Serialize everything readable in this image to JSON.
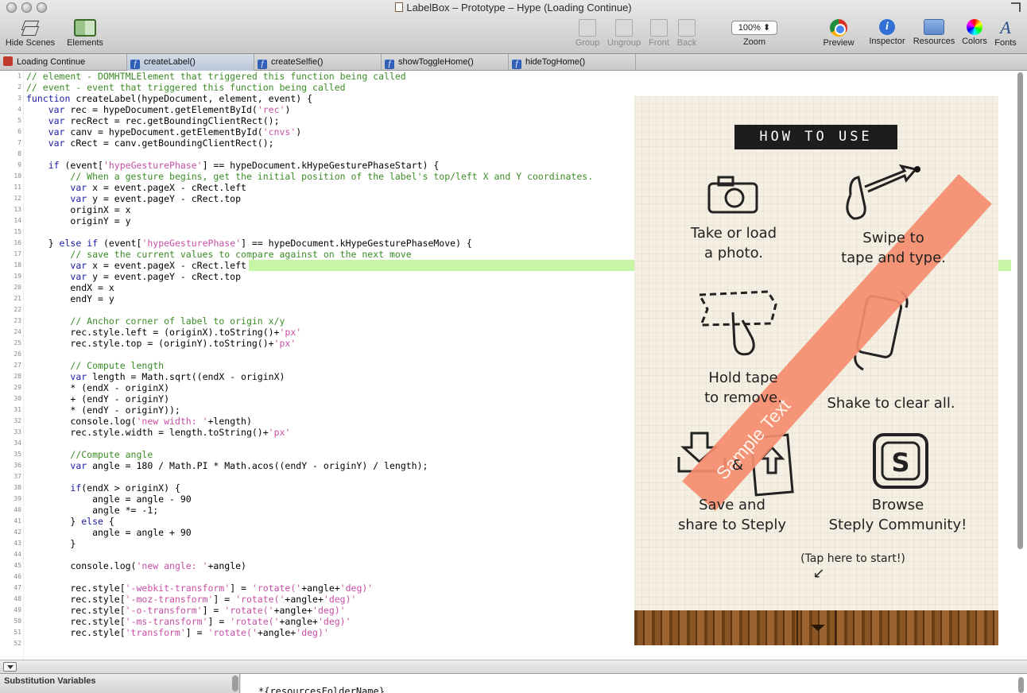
{
  "window": {
    "title": "LabelBox – Prototype – Hype (Loading Continue)"
  },
  "toolbar": {
    "hide_scenes": "Hide Scenes",
    "elements": "Elements",
    "group": "Group",
    "ungroup": "Ungroup",
    "front": "Front",
    "back": "Back",
    "zoom_value": "100%",
    "zoom_label": "Zoom",
    "preview": "Preview",
    "inspector": "Inspector",
    "resources": "Resources",
    "colors": "Colors",
    "fonts": "Fonts"
  },
  "tabs": [
    {
      "label": "Loading Continue",
      "kind": "scene",
      "active": false
    },
    {
      "label": "createLabel()",
      "kind": "function",
      "active": true
    },
    {
      "label": "createSelfie()",
      "kind": "function",
      "active": false
    },
    {
      "label": "showToggleHome()",
      "kind": "function",
      "active": false
    },
    {
      "label": "hideTogHome()",
      "kind": "function",
      "active": false
    }
  ],
  "code": {
    "highlighted_line": 18,
    "lines": [
      {
        "n": "1",
        "text": "// element - DOMHTMLElement that triggered this function being called"
      },
      {
        "n": "2",
        "text": "// event - event that triggered this function being called"
      },
      {
        "n": "3",
        "text": "function createLabel(hypeDocument, element, event) {"
      },
      {
        "n": "4",
        "text": "    var rec = hypeDocument.getElementById('rec')"
      },
      {
        "n": "5",
        "text": "    var recRect = rec.getBoundingClientRect();"
      },
      {
        "n": "6",
        "text": "    var canv = hypeDocument.getElementById('cnvs')"
      },
      {
        "n": "7",
        "text": "    var cRect = canv.getBoundingClientRect();"
      },
      {
        "n": "8",
        "text": ""
      },
      {
        "n": "9",
        "text": "    if (event['hypeGesturePhase'] == hypeDocument.kHypeGesturePhaseStart) {"
      },
      {
        "n": "10",
        "text": "        // When a gesture begins, get the initial position of the label's top/left X and Y coordinates."
      },
      {
        "n": "11",
        "text": "        var x = event.pageX - cRect.left"
      },
      {
        "n": "12",
        "text": "        var y = event.pageY - cRect.top"
      },
      {
        "n": "13",
        "text": "        originX = x"
      },
      {
        "n": "14",
        "text": "        originY = y"
      },
      {
        "n": "15",
        "text": ""
      },
      {
        "n": "16",
        "text": "    } else if (event['hypeGesturePhase'] == hypeDocument.kHypeGesturePhaseMove) {"
      },
      {
        "n": "17",
        "text": "        // save the current values to compare against on the next move"
      },
      {
        "n": "18",
        "text": "        var x = event.pageX - cRect.left"
      },
      {
        "n": "19",
        "text": "        var y = event.pageY - cRect.top"
      },
      {
        "n": "20",
        "text": "        endX = x"
      },
      {
        "n": "21",
        "text": "        endY = y"
      },
      {
        "n": "22",
        "text": ""
      },
      {
        "n": "23",
        "text": "        // Anchor corner of label to origin x/y"
      },
      {
        "n": "24",
        "text": "        rec.style.left = (originX).toString()+'px'"
      },
      {
        "n": "25",
        "text": "        rec.style.top = (originY).toString()+'px'"
      },
      {
        "n": "26",
        "text": ""
      },
      {
        "n": "27",
        "text": "        // Compute length"
      },
      {
        "n": "28",
        "text": "        var length = Math.sqrt((endX - originX)"
      },
      {
        "n": "29",
        "text": "        * (endX - originX)"
      },
      {
        "n": "30",
        "text": "        + (endY - originY)"
      },
      {
        "n": "31",
        "text": "        * (endY - originY));"
      },
      {
        "n": "32",
        "text": "        console.log('new width: '+length)"
      },
      {
        "n": "33",
        "text": "        rec.style.width = length.toString()+'px'"
      },
      {
        "n": "34",
        "text": ""
      },
      {
        "n": "35",
        "text": "        //Compute angle"
      },
      {
        "n": "36",
        "text": "        var angle = 180 / Math.PI * Math.acos((endY - originY) / length);"
      },
      {
        "n": "37",
        "text": ""
      },
      {
        "n": "38",
        "text": "        if(endX > originX) {"
      },
      {
        "n": "39",
        "text": "            angle = angle - 90"
      },
      {
        "n": "40",
        "text": "            angle *= -1;"
      },
      {
        "n": "41",
        "text": "        } else {"
      },
      {
        "n": "42",
        "text": "            angle = angle + 90"
      },
      {
        "n": "43",
        "text": "        }"
      },
      {
        "n": "44",
        "text": ""
      },
      {
        "n": "45",
        "text": "        console.log('new angle: '+angle)"
      },
      {
        "n": "46",
        "text": ""
      },
      {
        "n": "47",
        "text": "        rec.style['-webkit-transform'] = 'rotate('+angle+'deg)'"
      },
      {
        "n": "48",
        "text": "        rec.style['-moz-transform'] = 'rotate('+angle+'deg)'"
      },
      {
        "n": "49",
        "text": "        rec.style['-o-transform'] = 'rotate('+angle+'deg)'"
      },
      {
        "n": "50",
        "text": "        rec.style['-ms-transform'] = 'rotate('+angle+'deg)'"
      },
      {
        "n": "51",
        "text": "        rec.style['transform'] = 'rotate('+angle+'deg)'"
      },
      {
        "n": "52",
        "text": ""
      }
    ]
  },
  "preview": {
    "banner": "HOW TO USE",
    "tape_text": "Sample Text",
    "take_photo_1": "Take or load",
    "take_photo_2": "a photo.",
    "swipe_1": "Swipe to",
    "swipe_2": "tape and type.",
    "hold_1": "Hold tape",
    "hold_2": "to remove.",
    "shake": "Shake to clear all.",
    "save_1": "Save and",
    "save_2": "share to Steply",
    "ampersand": "&",
    "browse_1": "Browse",
    "browse_2": "Steply Community!",
    "tap_hint": "(Tap here to start!)"
  },
  "bottom": {
    "substitution_title": "Substitution Variables",
    "variable_text": "*{resourcesFolderName}"
  },
  "colors": {
    "keyword": "#1a1aa6",
    "string": "#c84ea6",
    "comment": "#3b8c26",
    "line_highlight": "#c6f6a5",
    "tape": "#f48c6e"
  }
}
